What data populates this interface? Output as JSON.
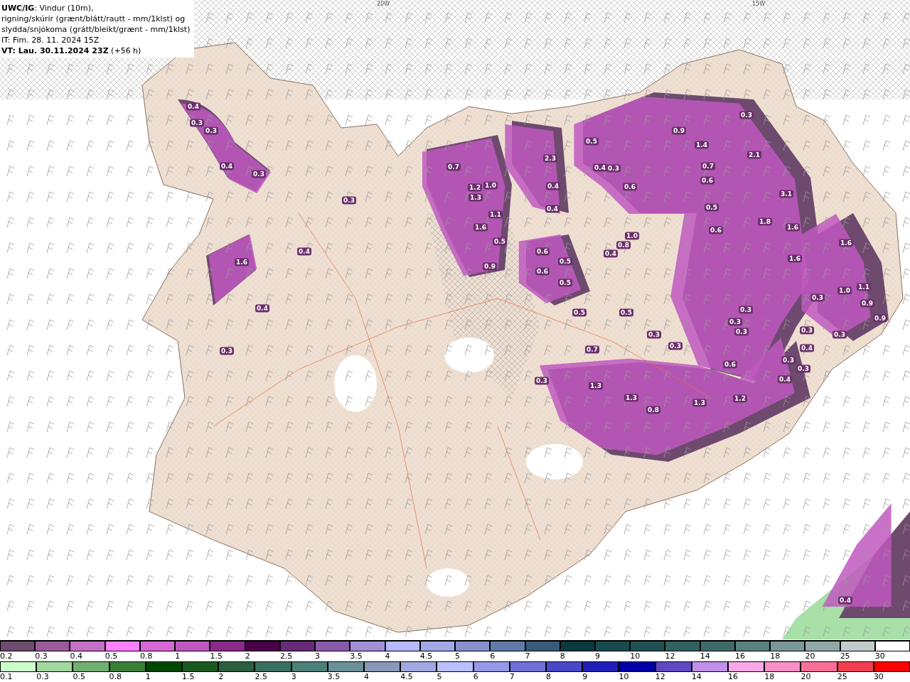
{
  "header": {
    "lines": [
      "**UWC/IG**: Vindur (10m),",
      "rigning/skúrir (grænt/blátt/rautt - mm/1klst) og",
      "slydda/snjókoma (grátt/bleikt/grænt - mm/1klst)",
      "IT: Fim. 28. 11. 2024 15Z",
      "**VT: Lau. 30.11.2024 23Z** (+56 h)"
    ]
  },
  "map": {
    "grid_labels": [
      "20W",
      "15W"
    ],
    "values": [
      "0.4",
      "0.3",
      "0.3",
      "0.4",
      "0.3",
      "0.3",
      "0.7",
      "1.2",
      "1.0",
      "1.3",
      "1.1",
      "1.6",
      "0.5",
      "0.9",
      "2.3",
      "0.4",
      "0.4",
      "0.5",
      "0.4",
      "0.3",
      "0.6",
      "0.9",
      "1.4",
      "0.7",
      "0.6",
      "2.1",
      "0.3",
      "3.1",
      "1.8",
      "1.6",
      "0.5",
      "0.6",
      "1.6",
      "1.0",
      "0.8",
      "0.4",
      "0.6",
      "0.6",
      "0.5",
      "0.5",
      "1.6",
      "1.0",
      "1.1",
      "0.9",
      "0.5",
      "0.5",
      "0.7",
      "0.3",
      "0.3",
      "0.3",
      "0.3",
      "0.3",
      "0.6",
      "0.3",
      "0.4",
      "0.3",
      "0.3",
      "0.4",
      "0.3",
      "1.3",
      "1.3",
      "0.8",
      "1.3",
      "1.2",
      "0.3",
      "1.6",
      "0.4",
      "0.4",
      "0.3",
      "0.4",
      "0.9",
      "0.3"
    ]
  },
  "legend": [
    {
      "swatches": [
        {
          "label": "0.2",
          "color": "#6e4a6e"
        },
        {
          "label": "0.3",
          "color": "#9b5b9b"
        },
        {
          "label": "0.4",
          "color": "#c670c6"
        },
        {
          "label": "0.5",
          "color": "#ff80ff"
        },
        {
          "label": "0.8",
          "color": "#d868d8"
        },
        {
          "label": "1",
          "color": "#c058c0"
        },
        {
          "label": "1.5",
          "color": "#8a2a8a"
        },
        {
          "label": "2",
          "color": "#4a0048"
        },
        {
          "label": "2.5",
          "color": "#6a2a7a"
        },
        {
          "label": "3",
          "color": "#8a5aaa"
        },
        {
          "label": "3.5",
          "color": "#a090d8"
        },
        {
          "label": "4",
          "color": "#b8b8ff"
        },
        {
          "label": "4.5",
          "color": "#a0a8e8"
        },
        {
          "label": "5",
          "color": "#8890d0"
        },
        {
          "label": "6",
          "color": "#607aa8"
        },
        {
          "label": "7",
          "color": "#3a5a78"
        },
        {
          "label": "8",
          "color": "#0a3a40"
        },
        {
          "label": "9",
          "color": "#184a50"
        },
        {
          "label": "10",
          "color": "#205055"
        },
        {
          "label": "12",
          "color": "#306060"
        },
        {
          "label": "14",
          "color": "#406a6a"
        },
        {
          "label": "16",
          "color": "#5a8080"
        },
        {
          "label": "18",
          "color": "#7a9898"
        },
        {
          "label": "20",
          "color": "#90a8a8"
        },
        {
          "label": "25",
          "color": "#c0cccc"
        },
        {
          "label": "30",
          "color": "#ffffff"
        }
      ]
    },
    {
      "swatches": [
        {
          "label": "0.1",
          "color": "#ccffcc"
        },
        {
          "label": "0.3",
          "color": "#a0d8a0"
        },
        {
          "label": "0.5",
          "color": "#70b070"
        },
        {
          "label": "0.8",
          "color": "#388038"
        },
        {
          "label": "1",
          "color": "#004800"
        },
        {
          "label": "1.5",
          "color": "#1a5a20"
        },
        {
          "label": "2",
          "color": "#2a6040"
        },
        {
          "label": "2.5",
          "color": "#3a7060"
        },
        {
          "label": "3",
          "color": "#4a8078"
        },
        {
          "label": "3.5",
          "color": "#6a9098"
        },
        {
          "label": "4",
          "color": "#8898b8"
        },
        {
          "label": "4.5",
          "color": "#a0a8e0"
        },
        {
          "label": "5",
          "color": "#b8c0ff"
        },
        {
          "label": "6",
          "color": "#9898e8"
        },
        {
          "label": "7",
          "color": "#7070d8"
        },
        {
          "label": "8",
          "color": "#4848c8"
        },
        {
          "label": "9",
          "color": "#2020b8"
        },
        {
          "label": "10",
          "color": "#0000a8"
        },
        {
          "label": "12",
          "color": "#6048c0"
        },
        {
          "label": "14",
          "color": "#c090e8"
        },
        {
          "label": "16",
          "color": "#f8a8e8"
        },
        {
          "label": "18",
          "color": "#f890c8"
        },
        {
          "label": "20",
          "color": "#f87098"
        },
        {
          "label": "25",
          "color": "#f04050"
        },
        {
          "label": "30",
          "color": "#ff0000"
        }
      ]
    }
  ]
}
